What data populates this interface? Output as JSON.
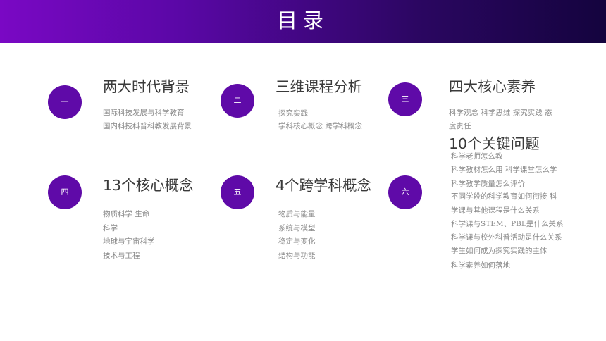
{
  "header": {
    "title": "目录"
  },
  "sections": [
    {
      "number": "一",
      "title": "两大时代背景",
      "items": [
        "国际科技发展与科学教育",
        "国内科技科普科教发展背景"
      ]
    },
    {
      "number": "二",
      "title": "三维课程分析",
      "items": [
        "探究实践",
        "学科核心概念 跨学科概念"
      ]
    },
    {
      "number": "三",
      "title": "四大核心素养",
      "items": [
        "科学观念 科学思维 探究实践 态",
        "度责任"
      ]
    },
    {
      "number": "四",
      "title": "13个核心概念",
      "items": [
        "物质科学 生命",
        "科学",
        "地球与宇宙科学",
        "技术与工程"
      ]
    },
    {
      "number": "五",
      "title": "4个跨学科概念",
      "items": [
        "物质与能量",
        "系统与模型",
        "稳定与变化",
        "结构与功能"
      ]
    },
    {
      "number": "六",
      "title": "10个关键问题",
      "items": [
        "科学老师怎么教",
        "科学教材怎么用 科学课堂怎么学",
        "科学教学质量怎么评价",
        "不同学段的科学教育如何衔接 科",
        "学课与其他课程是什么关系",
        "科学课与STEM、PBL是什么关系",
        "科学课与校外科普活动是什么关系",
        "学生如何成为探究实践的主体",
        "科学素养如何落地"
      ]
    }
  ]
}
